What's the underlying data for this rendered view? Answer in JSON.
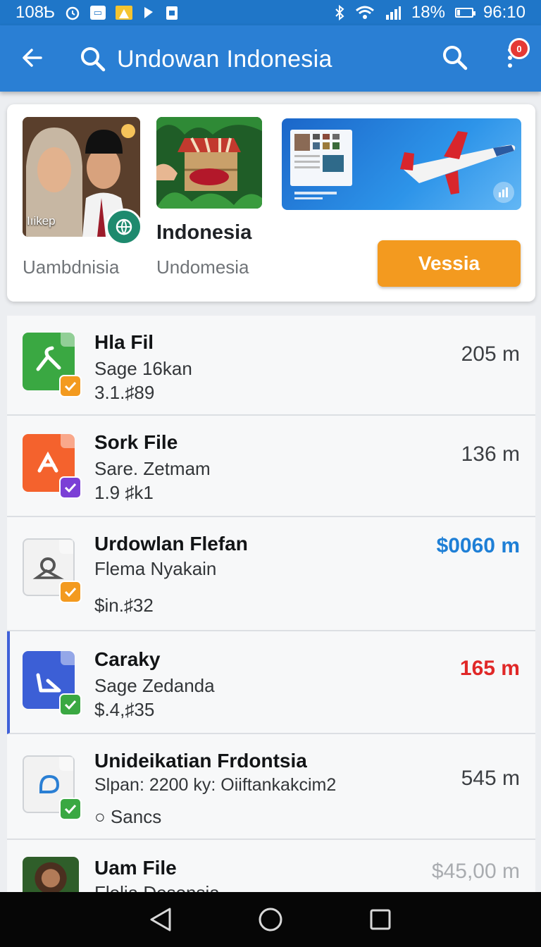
{
  "status_bar": {
    "left_text": "108Ƅ",
    "battery": "18%",
    "time": "96:10",
    "icons": [
      "alarm-icon",
      "cast-icon",
      "warning-icon",
      "signal-app-icon",
      "clipboard-icon",
      "bluetooth-icon",
      "wifi-icon",
      "cell-signal-icon",
      "battery-icon"
    ]
  },
  "app_bar": {
    "title": "Undowan Indonesia",
    "notification_count": "0",
    "back_icon": "arrow-left-icon",
    "search_icon": "search-icon",
    "menu_icon": "more-vertical-icon"
  },
  "featured": {
    "thumb1_caption": "Iıikep",
    "label1": "Uambdnisia",
    "heading": "Indonesia",
    "label2": "Undomesia",
    "button_label": "Vessia",
    "accent": "#f39a1f"
  },
  "files": [
    {
      "title": "Hla Fil",
      "subtitle": "Sage 16kan",
      "meta": "3.1.♯89",
      "value": "205 m",
      "value_color": "#3c3f43",
      "icon_color": "#3aa842",
      "check_color": "#f39a1f"
    },
    {
      "title": "Sork File",
      "subtitle": "Sare. Zetmam",
      "meta": "1.9 ♯k1",
      "value": "136 m",
      "value_color": "#3c3f43",
      "icon_color": "#f4622d",
      "check_color": "#7b3fd6"
    },
    {
      "title": "Urdowlan Flefan",
      "subtitle": "Flema Nyakain",
      "meta": "$in.♯32",
      "value": "$0060 m",
      "value_color": "#1e7fd6",
      "icon_color": "#f2f2f2",
      "check_color": "#f39a1f"
    },
    {
      "title": "Caraky",
      "subtitle": "Sage Zedanda",
      "meta": "$.4,♯35",
      "value": "165 m",
      "value_color": "#e02828",
      "icon_color": "#3c5fd6",
      "check_color": "#3aa842"
    },
    {
      "title": "Unideikatian Frdontsia",
      "subtitle": "Slpan: 2200 ky: Oiiftankakcim2",
      "meta": "○ Sancs",
      "value": "545 m",
      "value_color": "#3c3f43",
      "icon_color": "#f2f2f2",
      "check_color": "#3aa842"
    },
    {
      "title": "Uam File",
      "subtitle": "Flelia Desonsia",
      "meta": "",
      "value": "$45,00 m",
      "value_color": "#a9acb0"
    }
  ],
  "nav": {
    "back": "nav-back-icon",
    "home": "nav-home-icon",
    "recents": "nav-recents-icon"
  }
}
